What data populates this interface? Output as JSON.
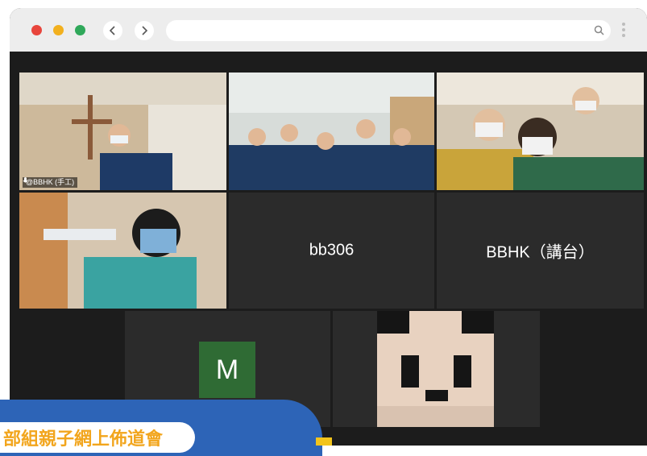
{
  "browser": {
    "url": "",
    "icons": [
      "close-dot",
      "minimize-dot",
      "maximize-dot",
      "back-arrow-icon",
      "forward-arrow-icon",
      "search-icon",
      "kebab-menu-icon"
    ],
    "colors": {
      "close": "#e8453c",
      "minimize": "#f2b01e",
      "maximize": "#2fa85a",
      "chrome": "#ededed"
    }
  },
  "meeting": {
    "participants": [
      {
        "id": "p1",
        "label": "@BBHK (手工)",
        "kind": "video",
        "active": true
      },
      {
        "id": "p2",
        "label": "",
        "kind": "video"
      },
      {
        "id": "p3",
        "label": "",
        "kind": "video"
      },
      {
        "id": "p4",
        "label": "",
        "kind": "video"
      },
      {
        "id": "p5",
        "label": "bb306",
        "kind": "name"
      },
      {
        "id": "p6",
        "label": "BBHK（講台）",
        "kind": "name"
      },
      {
        "id": "p7",
        "label": "M",
        "kind": "avatar"
      },
      {
        "id": "p8",
        "label": "",
        "kind": "image"
      }
    ],
    "active_color": "#c8d44a",
    "avatar_color": "#2f6b34"
  },
  "banner": {
    "title": "部組親子網上佈道會",
    "color": "#2d64b7",
    "text_color": "#f2a51c"
  }
}
